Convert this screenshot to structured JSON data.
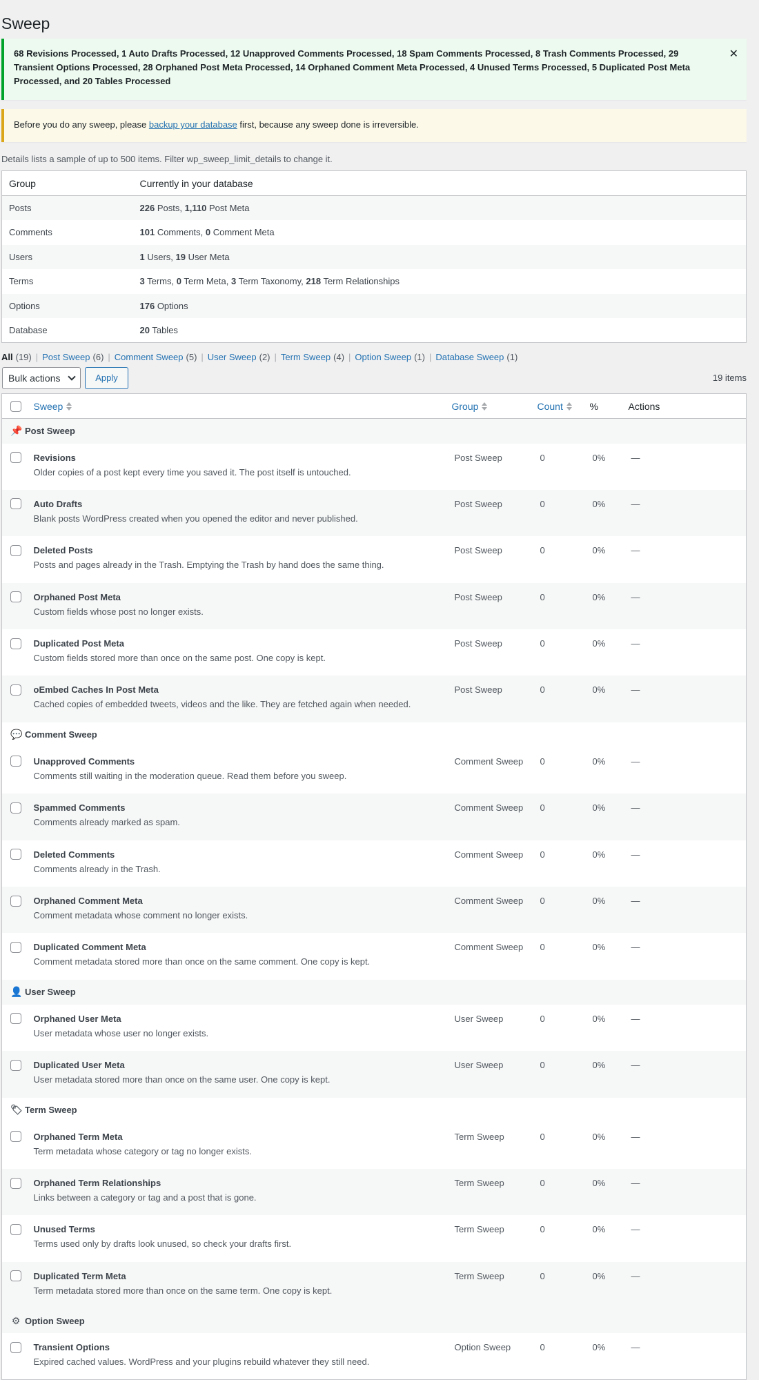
{
  "page": {
    "title": "Sweep"
  },
  "notice_success": {
    "text": "68 Revisions Processed, 1 Auto Drafts Processed, 12 Unapproved Comments Processed, 18 Spam Comments Processed, 8 Trash Comments Processed, 29 Transient Options Processed, 28 Orphaned Post Meta Processed, 14 Orphaned Comment Meta Processed, 4 Unused Terms Processed, 5 Duplicated Post Meta Processed, and 20 Tables Processed",
    "dismiss": "✕"
  },
  "notice_warning": {
    "before": "Before you do any sweep, please ",
    "link": "backup your database",
    "after": " first, because any sweep done is irreversible."
  },
  "details_text": "Details lists a sample of up to 500 items. Filter wp_sweep_limit_details to change it.",
  "stats": {
    "headers": [
      "Group",
      "Currently in your database"
    ],
    "rows": [
      {
        "group": "Posts",
        "parts": [
          [
            "226",
            " Posts, "
          ],
          [
            "1,110",
            " Post Meta"
          ]
        ]
      },
      {
        "group": "Comments",
        "parts": [
          [
            "101",
            " Comments, "
          ],
          [
            "0",
            " Comment Meta"
          ]
        ]
      },
      {
        "group": "Users",
        "parts": [
          [
            "1",
            " Users, "
          ],
          [
            "19",
            " User Meta"
          ]
        ]
      },
      {
        "group": "Terms",
        "parts": [
          [
            "3",
            " Terms, "
          ],
          [
            "0",
            " Term Meta, "
          ],
          [
            "3",
            " Term Taxonomy, "
          ],
          [
            "218",
            " Term Relationships"
          ]
        ]
      },
      {
        "group": "Options",
        "parts": [
          [
            "176",
            " Options"
          ]
        ]
      },
      {
        "group": "Database",
        "parts": [
          [
            "20",
            " Tables"
          ]
        ]
      }
    ]
  },
  "filters": [
    {
      "label": "All",
      "count": "(19)",
      "current": true
    },
    {
      "label": "Post Sweep",
      "count": "(6)"
    },
    {
      "label": "Comment Sweep",
      "count": "(5)"
    },
    {
      "label": "User Sweep",
      "count": "(2)"
    },
    {
      "label": "Term Sweep",
      "count": "(4)"
    },
    {
      "label": "Option Sweep",
      "count": "(1)"
    },
    {
      "label": "Database Sweep",
      "count": "(1)"
    }
  ],
  "tablenav": {
    "bulk_label": "Bulk actions",
    "apply_label": "Apply",
    "items_count": "19 items"
  },
  "columns": {
    "sweep": "Sweep",
    "group": "Group",
    "count": "Count",
    "pct": "%",
    "actions": "Actions"
  },
  "groups": [
    {
      "name": "Post Sweep",
      "icon": "pushpin-icon",
      "glyph": "📌",
      "items": [
        {
          "title": "Revisions",
          "desc": "Older copies of a post kept every time you saved it. The post itself is untouched.",
          "group": "Post Sweep",
          "count": "0",
          "pct": "0%",
          "action": "—"
        },
        {
          "title": "Auto Drafts",
          "desc": "Blank posts WordPress created when you opened the editor and never published.",
          "group": "Post Sweep",
          "count": "0",
          "pct": "0%",
          "action": "—"
        },
        {
          "title": "Deleted Posts",
          "desc": "Posts and pages already in the Trash. Emptying the Trash by hand does the same thing.",
          "group": "Post Sweep",
          "count": "0",
          "pct": "0%",
          "action": "—"
        },
        {
          "title": "Orphaned Post Meta",
          "desc": "Custom fields whose post no longer exists.",
          "group": "Post Sweep",
          "count": "0",
          "pct": "0%",
          "action": "—"
        },
        {
          "title": "Duplicated Post Meta",
          "desc": "Custom fields stored more than once on the same post. One copy is kept.",
          "group": "Post Sweep",
          "count": "0",
          "pct": "0%",
          "action": "—"
        },
        {
          "title": "oEmbed Caches In Post Meta",
          "desc": "Cached copies of embedded tweets, videos and the like. They are fetched again when needed.",
          "group": "Post Sweep",
          "count": "0",
          "pct": "0%",
          "action": "—"
        }
      ]
    },
    {
      "name": "Comment Sweep",
      "icon": "speech-bubble-icon",
      "glyph": "💬",
      "items": [
        {
          "title": "Unapproved Comments",
          "desc": "Comments still waiting in the moderation queue. Read them before you sweep.",
          "group": "Comment Sweep",
          "count": "0",
          "pct": "0%",
          "action": "—"
        },
        {
          "title": "Spammed Comments",
          "desc": "Comments already marked as spam.",
          "group": "Comment Sweep",
          "count": "0",
          "pct": "0%",
          "action": "—"
        },
        {
          "title": "Deleted Comments",
          "desc": "Comments already in the Trash.",
          "group": "Comment Sweep",
          "count": "0",
          "pct": "0%",
          "action": "—"
        },
        {
          "title": "Orphaned Comment Meta",
          "desc": "Comment metadata whose comment no longer exists.",
          "group": "Comment Sweep",
          "count": "0",
          "pct": "0%",
          "action": "—"
        },
        {
          "title": "Duplicated Comment Meta",
          "desc": "Comment metadata stored more than once on the same comment. One copy is kept.",
          "group": "Comment Sweep",
          "count": "0",
          "pct": "0%",
          "action": "—"
        }
      ]
    },
    {
      "name": "User Sweep",
      "icon": "user-icon",
      "glyph": "👤",
      "items": [
        {
          "title": "Orphaned User Meta",
          "desc": "User metadata whose user no longer exists.",
          "group": "User Sweep",
          "count": "0",
          "pct": "0%",
          "action": "—"
        },
        {
          "title": "Duplicated User Meta",
          "desc": "User metadata stored more than once on the same user. One copy is kept.",
          "group": "User Sweep",
          "count": "0",
          "pct": "0%",
          "action": "—"
        }
      ]
    },
    {
      "name": "Term Sweep",
      "icon": "tag-icon",
      "glyph": "🏷",
      "items": [
        {
          "title": "Orphaned Term Meta",
          "desc": "Term metadata whose category or tag no longer exists.",
          "group": "Term Sweep",
          "count": "0",
          "pct": "0%",
          "action": "—"
        },
        {
          "title": "Orphaned Term Relationships",
          "desc": "Links between a category or tag and a post that is gone.",
          "group": "Term Sweep",
          "count": "0",
          "pct": "0%",
          "action": "—"
        },
        {
          "title": "Unused Terms",
          "desc": "Terms used only by drafts look unused, so check your drafts first.",
          "group": "Term Sweep",
          "count": "0",
          "pct": "0%",
          "action": "—"
        },
        {
          "title": "Duplicated Term Meta",
          "desc": "Term metadata stored more than once on the same term. One copy is kept.",
          "group": "Term Sweep",
          "count": "0",
          "pct": "0%",
          "action": "—"
        }
      ]
    },
    {
      "name": "Option Sweep",
      "icon": "settings-panel-icon",
      "glyph": "⚙",
      "items": [
        {
          "title": "Transient Options",
          "desc": "Expired cached values. WordPress and your plugins rebuild whatever they still need.",
          "group": "Option Sweep",
          "count": "0",
          "pct": "0%",
          "action": "—"
        }
      ]
    }
  ]
}
